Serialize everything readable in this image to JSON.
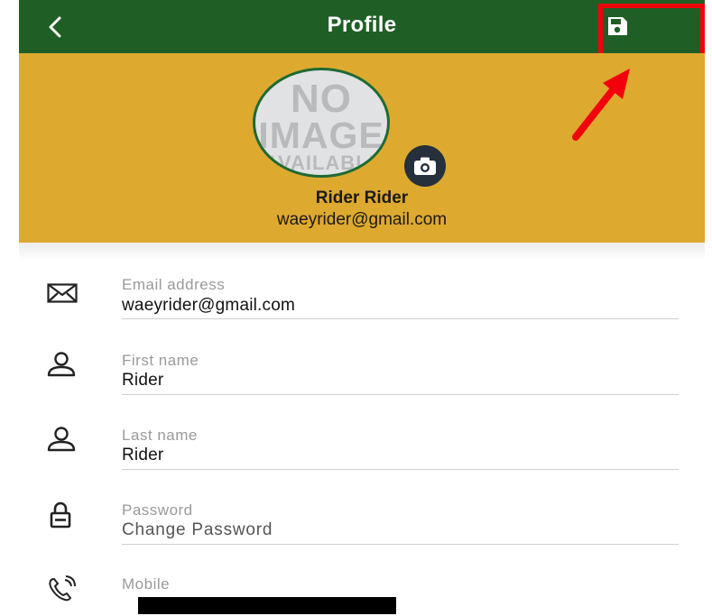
{
  "header": {
    "title": "Profile",
    "back_icon": "chevron-left-icon",
    "save_icon": "floppy-disk-icon"
  },
  "profile": {
    "avatar_text": [
      "NO",
      "IMAGE",
      "AVAILABLE"
    ],
    "camera_icon": "camera-icon",
    "name": "Rider Rider",
    "email": "waeyrider@gmail.com"
  },
  "fields": [
    {
      "icon": "envelope-icon",
      "label": "Email address",
      "value": "waeyrider@gmail.com"
    },
    {
      "icon": "person-icon",
      "label": "First name",
      "value": "Rider"
    },
    {
      "icon": "person-icon",
      "label": "Last name",
      "value": "Rider"
    },
    {
      "icon": "lock-icon",
      "label": "Password",
      "value": "Change Password"
    },
    {
      "icon": "phone-icon",
      "label": "Mobile",
      "value": ""
    }
  ],
  "colors": {
    "topbar": "#1f5f25",
    "header_bg": "#dea92f",
    "highlight": "#f2000b",
    "camera_bg": "#25303c"
  }
}
